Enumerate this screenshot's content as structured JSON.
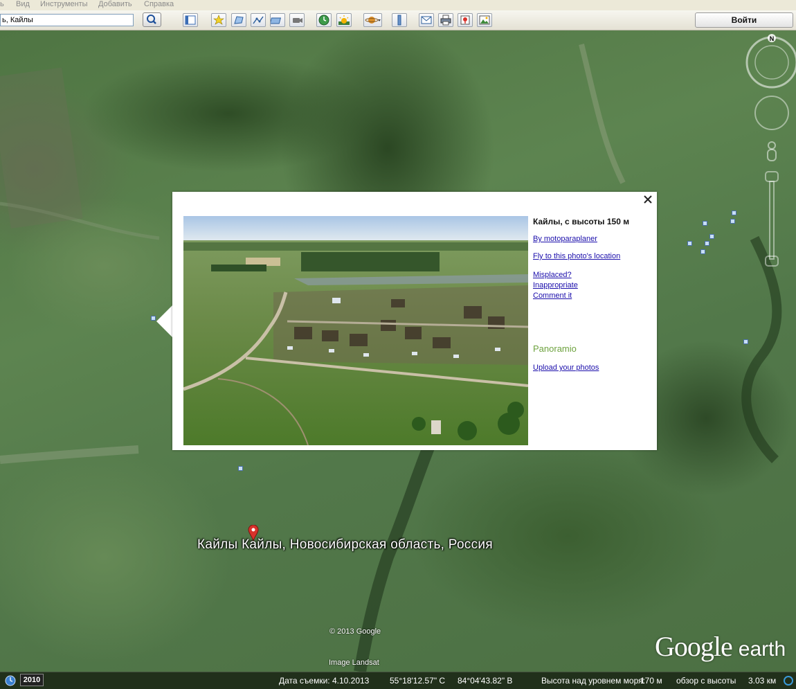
{
  "menubar": {
    "items": [
      "ь",
      "Вид",
      "Инструменты",
      "Добавить",
      "Справка"
    ]
  },
  "toolbar": {
    "search_value": "ь, Кайлы",
    "search_button_icon": "search-icon",
    "buttons": [
      "sidebar-toggle-icon",
      "placemark-icon",
      "polygon-icon",
      "path-icon",
      "image-overlay-icon",
      "record-tour-icon",
      "historical-imagery-icon",
      "sunlight-icon",
      "planets-icon",
      "ruler-icon",
      "email-icon",
      "print-icon",
      "google-maps-icon",
      "save-image-icon"
    ],
    "login_label": "Войти"
  },
  "map": {
    "place_label": "Кайлы  Кайлы, Новосибирская область, Россия",
    "copyright": "© 2013 Google",
    "imagery": "Image Landsat",
    "logo": {
      "google": "Google",
      "earth": "earth"
    },
    "compass_north": "N"
  },
  "popup": {
    "title": "Кайлы, с высоты 150 м",
    "author_link": "By motoparaplaner",
    "fly_link": "Fly to this photo's location",
    "misplaced_link": "Misplaced?",
    "inappropriate_link": "Inappropriate",
    "comment_link": "Comment it",
    "brand": "Panoramio",
    "upload_link": "Upload your photos",
    "close_icon": "close-icon"
  },
  "statusbar": {
    "year": "2010",
    "date": "Дата съемки: 4.10.2013",
    "lat": "55°18'12.57\" С",
    "lon": "84°04'43.82\" В",
    "elev_label": "Высота над уровнем моря:",
    "elev_value": "170 м",
    "eye_label": "обзор с высоты",
    "eye_value": "3.03 км"
  },
  "colors": {
    "link": "#1a0dab",
    "panoramio": "#6da23e",
    "pin": "#d9322b"
  }
}
